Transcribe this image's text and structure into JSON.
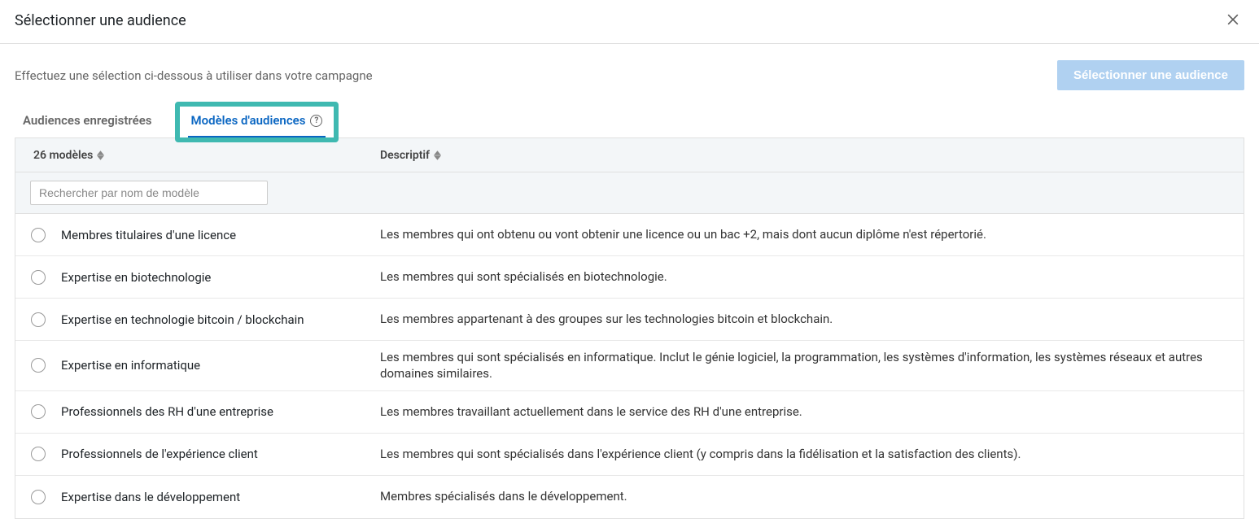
{
  "modal": {
    "title": "Sélectionner une audience",
    "subtitle": "Effectuez une sélection ci-dessous à utiliser dans votre campagne",
    "select_button": "Sélectionner une audience"
  },
  "tabs": {
    "saved": "Audiences enregistrées",
    "templates": "Modèles d'audiences"
  },
  "table": {
    "count_header": "26 modèles",
    "desc_header": "Descriptif",
    "search_placeholder": "Rechercher par nom de modèle"
  },
  "rows": [
    {
      "name": "Membres titulaires d'une licence",
      "desc": "Les membres qui ont obtenu ou vont obtenir une licence ou un bac +2, mais dont aucun diplôme n'est répertorié."
    },
    {
      "name": "Expertise en biotechnologie",
      "desc": "Les membres qui sont spécialisés en biotechnologie."
    },
    {
      "name": "Expertise en technologie bitcoin / blockchain",
      "desc": "Les membres appartenant à des groupes sur les technologies bitcoin et blockchain."
    },
    {
      "name": "Expertise en informatique",
      "desc": "Les membres qui sont spécialisés en informatique. Inclut le génie logiciel, la programmation, les systèmes d'information, les systèmes réseaux et autres domaines similaires."
    },
    {
      "name": "Professionnels des RH d'une entreprise",
      "desc": "Les membres travaillant actuellement dans le service des RH d'une entreprise."
    },
    {
      "name": "Professionnels de l'expérience client",
      "desc": "Les membres qui sont spécialisés dans l'expérience client (y compris dans la fidélisation et la satisfaction des clients)."
    },
    {
      "name": "Expertise dans le développement",
      "desc": "Membres spécialisés dans le développement."
    }
  ]
}
